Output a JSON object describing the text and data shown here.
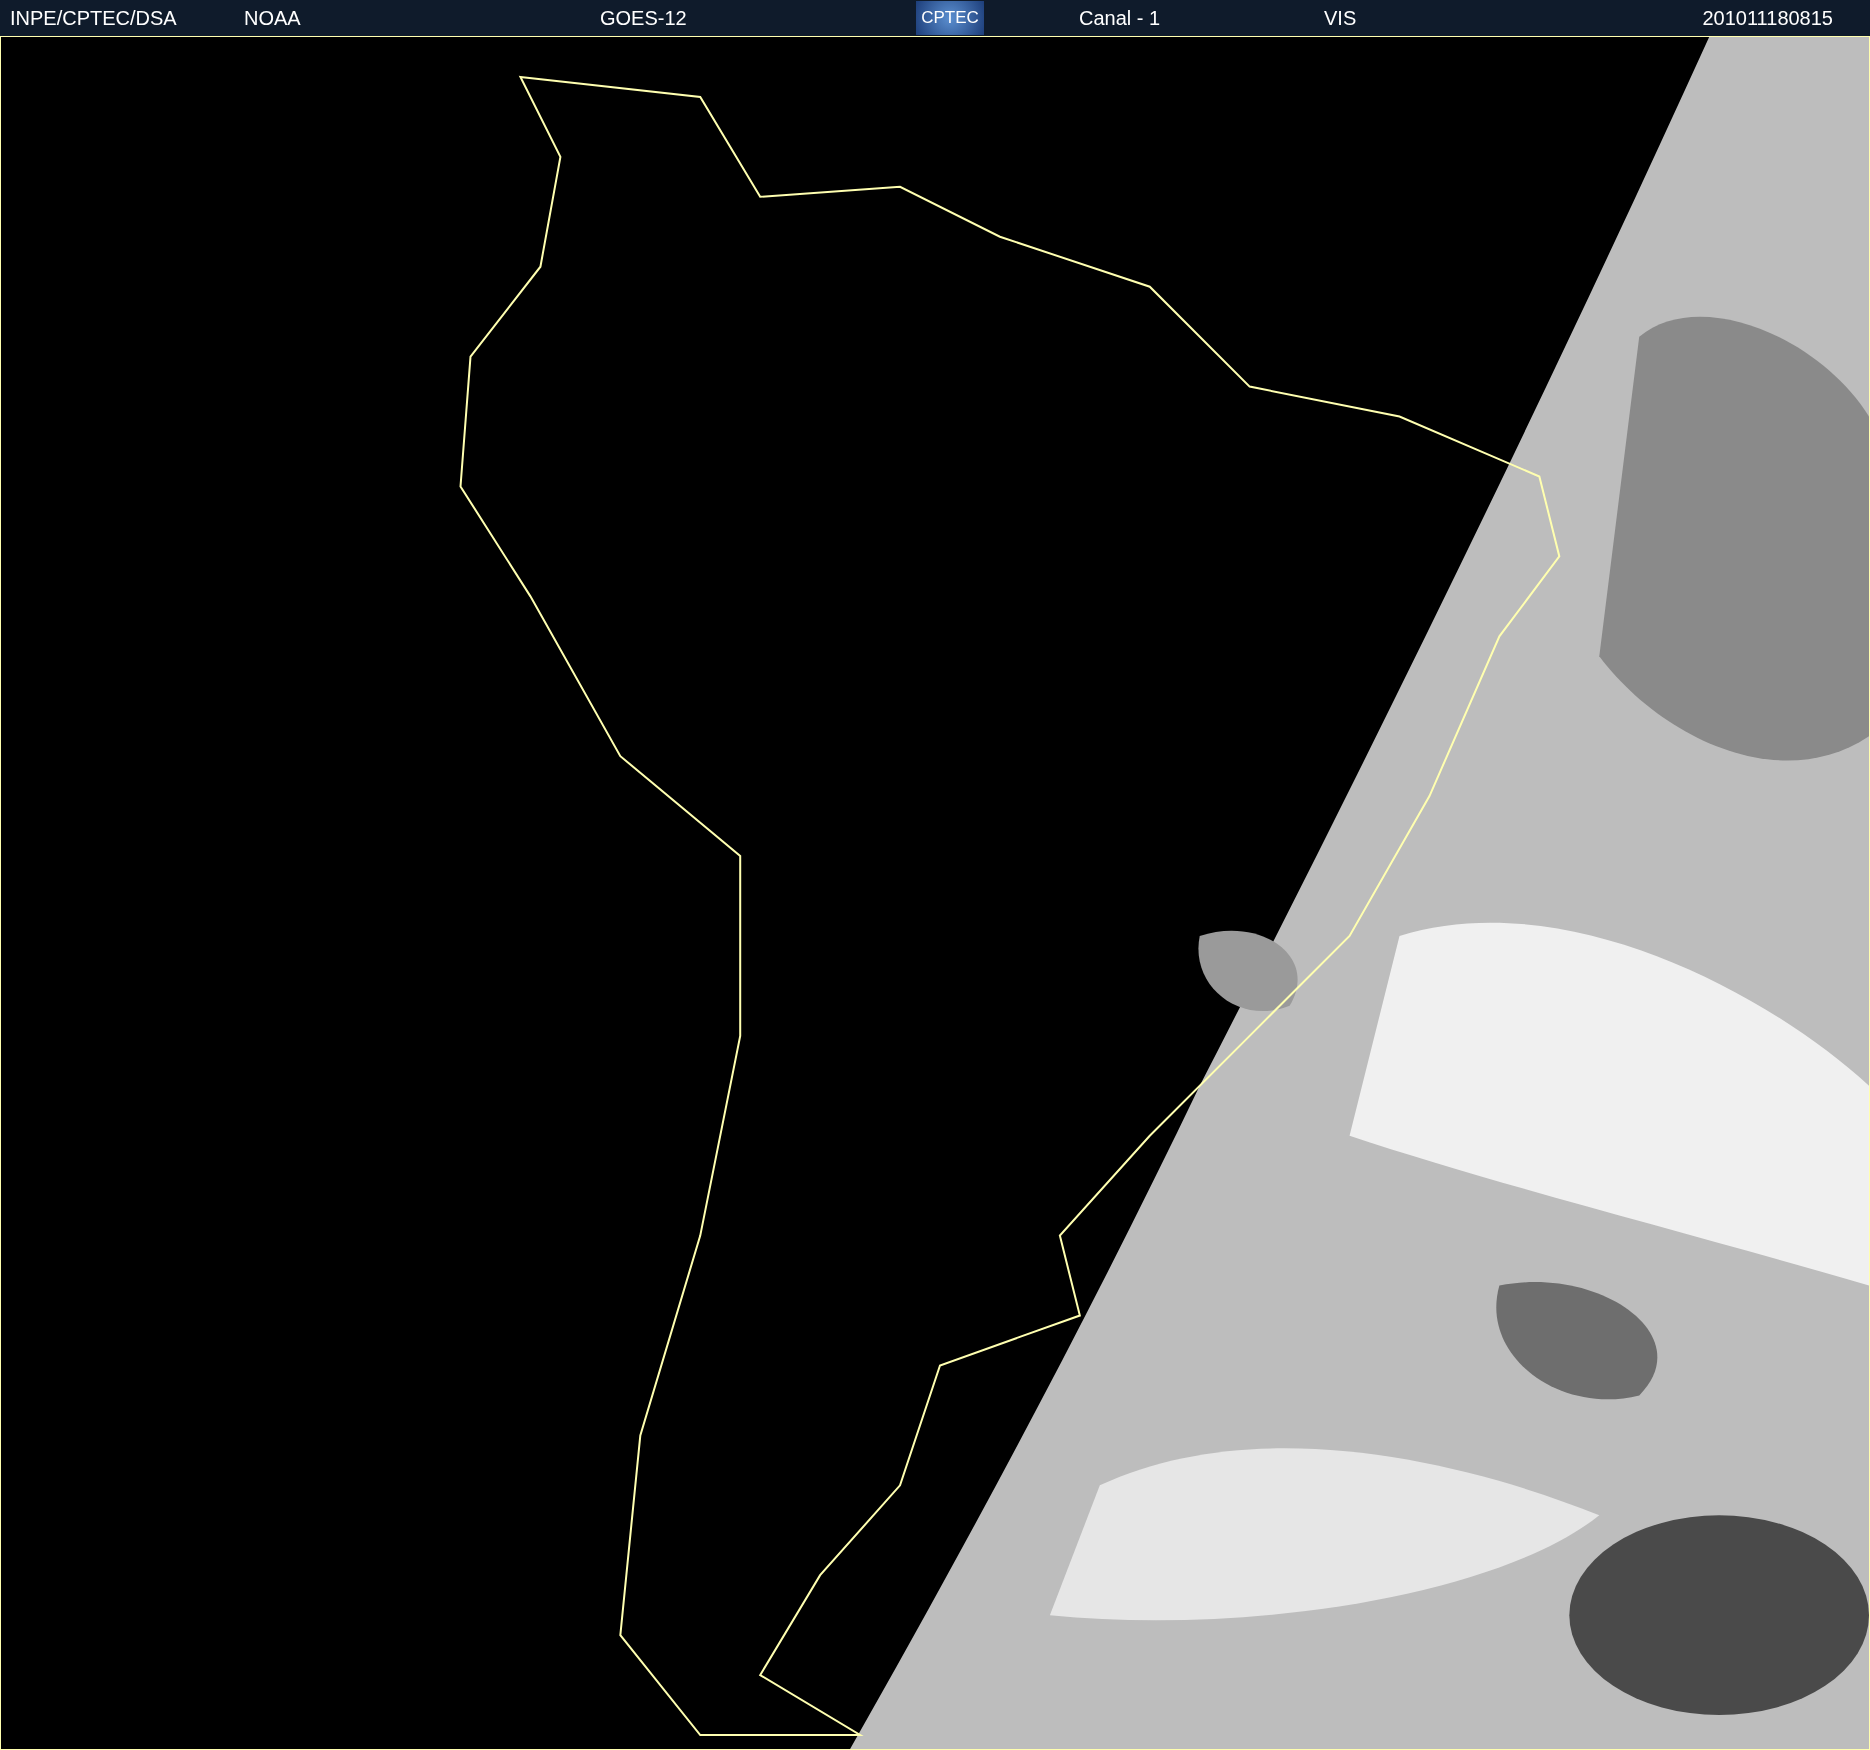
{
  "header": {
    "source": "INPE/CPTEC/DSA",
    "agency": "NOAA",
    "satellite": "GOES-12",
    "logo": "CPTEC",
    "channel": "Canal - 1",
    "band": "VIS",
    "timestamp": "201011180815"
  }
}
